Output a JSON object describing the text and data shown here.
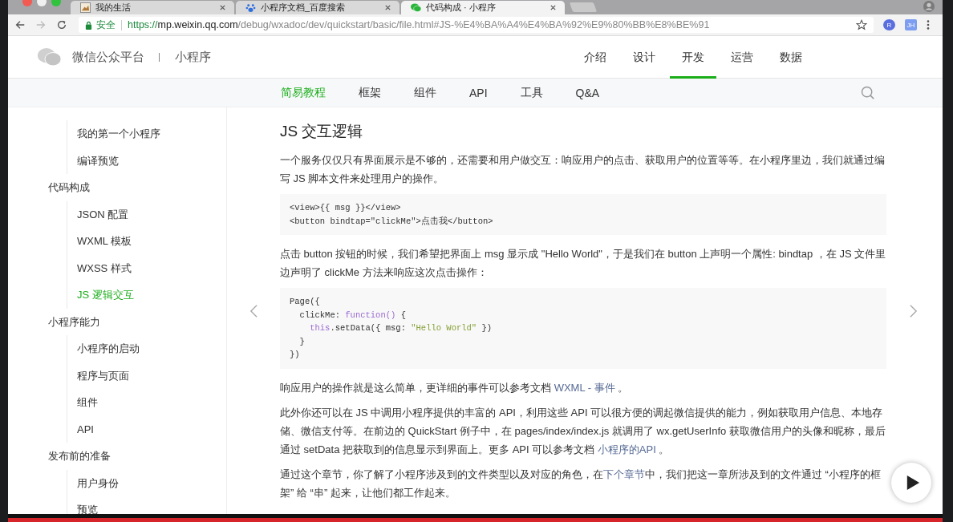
{
  "browser": {
    "tabs": [
      {
        "title": "我的生活",
        "selected": false
      },
      {
        "title": "小程序文档_百度搜索",
        "selected": false
      },
      {
        "title": "代码构成 · 小程序",
        "selected": true
      }
    ],
    "security_label": "安全",
    "url": {
      "scheme": "https://",
      "host": "mp.weixin.qq.com",
      "path": "/debug/wxadoc/dev/quickstart/basic/file.html#JS-%E4%BA%A4%E4%BA%92%E9%80%BB%E8%BE%91"
    },
    "extensions": [
      "R",
      "JH"
    ]
  },
  "video": {
    "level": 1
  },
  "site_header": {
    "brand": "微信公众平台",
    "product": "小程序",
    "nav": [
      {
        "label": "介绍",
        "selected": false
      },
      {
        "label": "设计",
        "selected": false
      },
      {
        "label": "开发",
        "selected": true
      },
      {
        "label": "运营",
        "selected": false
      },
      {
        "label": "数据",
        "selected": false
      }
    ]
  },
  "subnav": [
    {
      "label": "简易教程",
      "selected": true
    },
    {
      "label": "框架",
      "selected": false
    },
    {
      "label": "组件",
      "selected": false
    },
    {
      "label": "API",
      "selected": false
    },
    {
      "label": "工具",
      "selected": false
    },
    {
      "label": "Q&A",
      "selected": false
    }
  ],
  "sidebar": {
    "sections": [
      {
        "children": [
          {
            "label": "我的第一个小程序",
            "selected": false
          },
          {
            "label": "编译预览",
            "selected": false
          }
        ]
      },
      {
        "title": "代码构成",
        "children": [
          {
            "label": "JSON 配置",
            "selected": false
          },
          {
            "label": "WXML 模板",
            "selected": false
          },
          {
            "label": "WXSS 样式",
            "selected": false
          },
          {
            "label": "JS 逻辑交互",
            "selected": true
          }
        ]
      },
      {
        "title": "小程序能力",
        "children": [
          {
            "label": "小程序的启动",
            "selected": false
          },
          {
            "label": "程序与页面",
            "selected": false
          },
          {
            "label": "组件",
            "selected": false
          },
          {
            "label": "API",
            "selected": false
          }
        ]
      },
      {
        "title": "发布前的准备",
        "children": [
          {
            "label": "用户身份",
            "selected": false
          },
          {
            "label": "预览",
            "selected": false
          }
        ]
      }
    ]
  },
  "article": {
    "title": "JS 交互逻辑",
    "blocks": [
      {
        "kind": "paragraph",
        "parts": [
          {
            "kind": "text",
            "text": "一个服务仅仅只有界面展示是不够的，还需要和用户做交互：响应用户的点击、获取用户的位置等等。在小程序里边，我们就通过编写 JS 脚本文件来处理用户的操作。"
          }
        ]
      },
      {
        "kind": "code",
        "lines": [
          [
            {
              "kind": "plain",
              "text": "<view>{{ msg }}</view>"
            }
          ],
          [
            {
              "kind": "plain",
              "text": "<button bindtap=\"clickMe\">点击我</button>"
            }
          ]
        ]
      },
      {
        "kind": "paragraph",
        "parts": [
          {
            "kind": "text",
            "text": "点击 button 按钮的时候，我们希望把界面上 msg 显示成 \"Hello World\"，于是我们在 button 上声明一个属性: bindtap ，在 JS 文件里边声明了 clickMe 方法来响应这次点击操作："
          }
        ]
      },
      {
        "kind": "code",
        "lines": [
          [
            {
              "kind": "plain",
              "text": "Page({"
            }
          ],
          [
            {
              "kind": "plain",
              "text": "  clickMe: "
            },
            {
              "kind": "keyword",
              "text": "function()"
            },
            {
              "kind": "plain",
              "text": " {"
            }
          ],
          [
            {
              "kind": "keyword",
              "text": "    this"
            },
            {
              "kind": "plain",
              "text": ".setData({ msg: "
            },
            {
              "kind": "string",
              "text": "\"Hello World\""
            },
            {
              "kind": "plain",
              "text": " })"
            }
          ],
          [
            {
              "kind": "plain",
              "text": "  }"
            }
          ],
          [
            {
              "kind": "plain",
              "text": "})"
            }
          ]
        ]
      },
      {
        "kind": "paragraph",
        "parts": [
          {
            "kind": "text",
            "text": "响应用户的操作就是这么简单，更详细的事件可以参考文档 "
          },
          {
            "kind": "link",
            "text": "WXML - 事件"
          },
          {
            "kind": "text",
            "text": " 。"
          }
        ]
      },
      {
        "kind": "paragraph",
        "parts": [
          {
            "kind": "text",
            "text": "此外你还可以在 JS 中调用小程序提供的丰富的 API，利用这些 API 可以很方便的调起微信提供的能力，例如获取用户信息、本地存储、微信支付等。在前边的 QuickStart 例子中，在 pages/index/index.js 就调用了 wx.getUserInfo 获取微信用户的头像和昵称，最后通过 setData 把获取到的信息显示到界面上。更多 API 可以参考文档 "
          },
          {
            "kind": "link",
            "text": "小程序的API"
          },
          {
            "kind": "text",
            "text": " 。"
          }
        ]
      },
      {
        "kind": "paragraph",
        "parts": [
          {
            "kind": "text",
            "text": "通过这个章节，你了解了小程序涉及到的文件类型以及对应的角色，在"
          },
          {
            "kind": "link",
            "text": "下个章节"
          },
          {
            "kind": "text",
            "text": "中，我们把这一章所涉及到的文件通过 “小程序的框架” 给 “串” 起来，让他们都工作起来。"
          }
        ]
      }
    ]
  }
}
